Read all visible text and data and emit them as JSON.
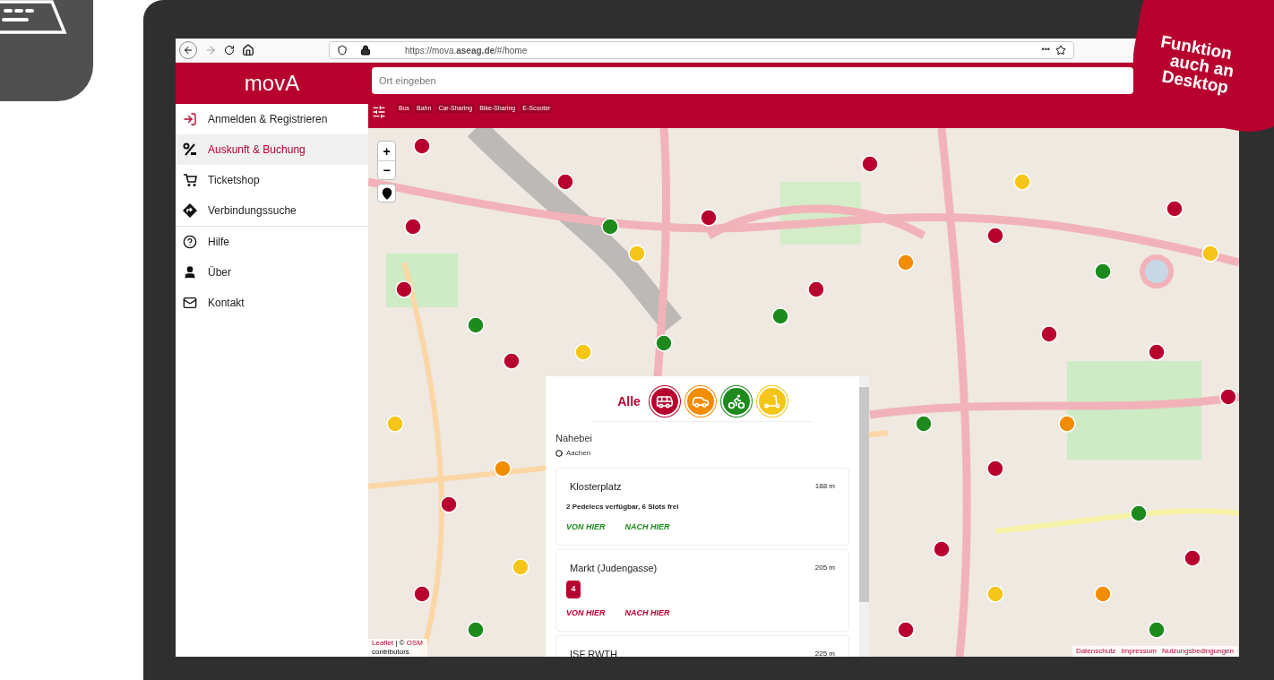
{
  "badge": {
    "lines": [
      "Funktion",
      "auch an",
      "Desktop"
    ]
  },
  "browser": {
    "url": "https://mova.**aseag.de**/#/home",
    "menu": "•••"
  },
  "app": {
    "logo": "movA",
    "search": {
      "placeholder": "Ort eingeben"
    },
    "filters": [
      "Bus",
      "Bahn",
      "Car-Sharing",
      "Bike-Sharing",
      "E-Scooter"
    ]
  },
  "sidebar": {
    "groups": [
      {
        "items": [
          {
            "label": "Anmelden & Registrieren",
            "selected": false
          },
          {
            "label": "Auskunft & Buchung",
            "selected": true
          },
          {
            "label": "Ticketshop",
            "selected": false
          },
          {
            "label": "Verbindungssuche",
            "selected": false
          }
        ]
      },
      {
        "items": [
          {
            "label": "Hilfe",
            "selected": false
          },
          {
            "label": "Über",
            "selected": false
          },
          {
            "label": "Kontakt",
            "selected": false
          }
        ]
      }
    ]
  },
  "map": {
    "zoom_in": "+",
    "zoom_out": "−",
    "attribution": {
      "leaflet": "Leaflet",
      "middle": "| ©",
      "osm": "OSM",
      "suffix": "contributors"
    },
    "footer_links": [
      "Datenschutz",
      "Impressum",
      "Nutzungsbedingungen"
    ]
  },
  "panel": {
    "all_label": "Alle",
    "modes": [
      {
        "kind": "bus",
        "color": "#b8002f"
      },
      {
        "kind": "car",
        "color": "#f28c00"
      },
      {
        "kind": "bike",
        "color": "#1e8a1e"
      },
      {
        "kind": "scooter",
        "color": "#f5c518"
      }
    ],
    "nearby": {
      "title": "Nahebei",
      "location": "Aachen"
    },
    "results": [
      {
        "name": "Klosterplatz",
        "distance": "188 m",
        "info": "2 Pedelecs verfügbar, 6 Slots frei",
        "color": "#1e8a1e",
        "actions": [
          "VON HIER",
          "NACH HIER"
        ]
      },
      {
        "name": "Markt (Judengasse)",
        "distance": "205 m",
        "lines": [
          "4"
        ],
        "color": "#b8002f",
        "actions": [
          "VON HIER",
          "NACH HIER"
        ]
      },
      {
        "name": "ISF RWTH",
        "distance": "225 m"
      }
    ]
  }
}
